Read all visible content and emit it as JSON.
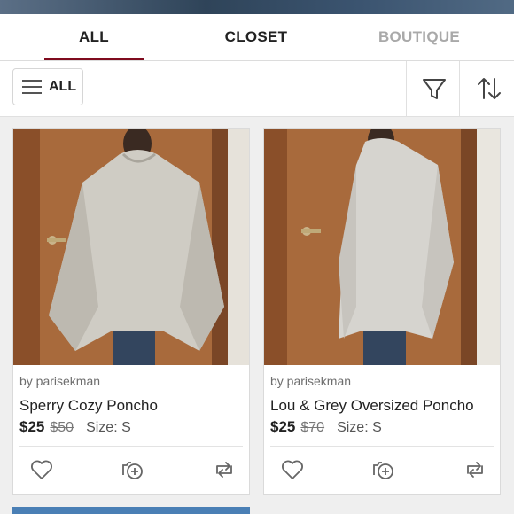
{
  "tabs": [
    {
      "label": "ALL",
      "active": true
    },
    {
      "label": "CLOSET",
      "active": false
    },
    {
      "label": "BOUTIQUE",
      "active": false
    }
  ],
  "toolbar": {
    "filter_label": "ALL",
    "filter_icon": "hamburger-icon",
    "funnel_icon": "funnel-icon",
    "sort_icon": "sort-arrows-icon"
  },
  "listings": [
    {
      "seller": "by parisekman",
      "title": "Sperry Cozy Poncho",
      "price": "$25",
      "original_price": "$50",
      "size": "Size: S"
    },
    {
      "seller": "by parisekman",
      "title": "Lou & Grey Oversized Poncho",
      "price": "$25",
      "original_price": "$70",
      "size": "Size: S"
    }
  ],
  "colors": {
    "accent": "#7f0b1e",
    "inactive_tab": "#a9a9a9",
    "text": "#222222"
  }
}
